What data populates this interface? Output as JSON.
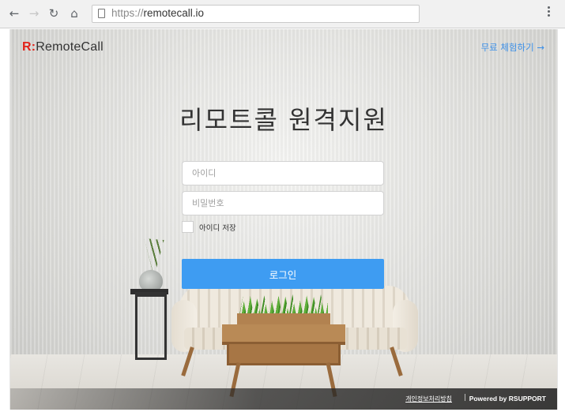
{
  "browser": {
    "url_protocol": "https://",
    "url_host": "remotecall.io",
    "back_icon": "arrow-left",
    "forward_icon": "arrow-right",
    "reload_icon": "reload",
    "home_icon": "home",
    "menu_icon": "kebab"
  },
  "header": {
    "logo_mark": "R:",
    "logo_text": "RemoteCall",
    "trial_link": "무료 체험하기 →"
  },
  "main": {
    "title": "리모트콜 원격지원",
    "id_placeholder": "아이디",
    "password_placeholder": "비밀번호",
    "remember_label": "아이디 저장",
    "remember_checked": false,
    "login_button": "로그인"
  },
  "footer": {
    "privacy": "개인정보처리방침",
    "separator": "|",
    "powered": "Powered by RSUPPORT"
  },
  "colors": {
    "accent": "#3e9cf2",
    "logo_red": "#e2231a",
    "link_blue": "#3b8fe8"
  }
}
